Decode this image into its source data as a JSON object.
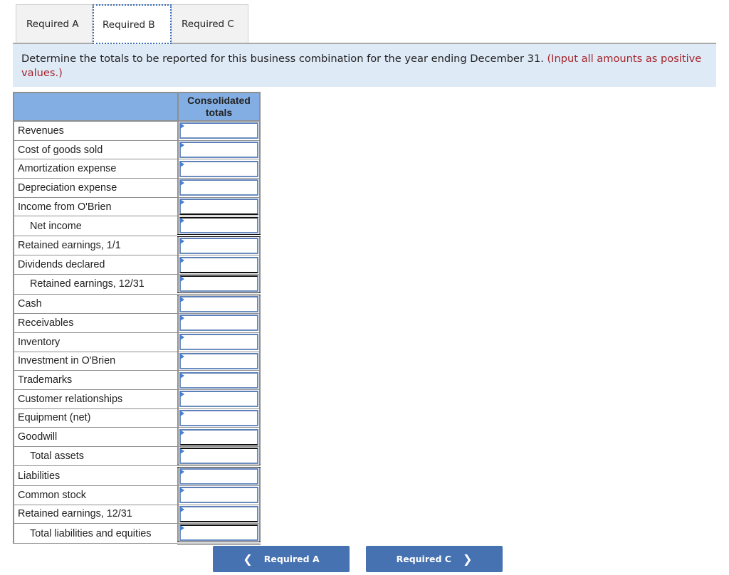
{
  "tabs": [
    {
      "label": "Required A",
      "active": false
    },
    {
      "label": "Required B",
      "active": true
    },
    {
      "label": "Required C",
      "active": false
    }
  ],
  "instruction": {
    "text": "Determine the totals to be reported for this business combination for the year ending December 31. ",
    "note": "(Input all amounts as positive values.)"
  },
  "table": {
    "header_label": "",
    "header_value": "Consolidated totals",
    "rows": [
      {
        "label": "Revenues",
        "value": "",
        "indent": false,
        "total": false
      },
      {
        "label": "Cost of goods sold",
        "value": "",
        "indent": false,
        "total": false
      },
      {
        "label": "Amortization expense",
        "value": "",
        "indent": false,
        "total": false
      },
      {
        "label": "Depreciation expense",
        "value": "",
        "indent": false,
        "total": false
      },
      {
        "label": "Income from O'Brien",
        "value": "",
        "indent": false,
        "total": false
      },
      {
        "label": "Net income",
        "value": "",
        "indent": true,
        "total": true
      },
      {
        "label": "Retained earnings, 1/1",
        "value": "",
        "indent": false,
        "total": false
      },
      {
        "label": "Dividends declared",
        "value": "",
        "indent": false,
        "total": false
      },
      {
        "label": "Retained earnings, 12/31",
        "value": "",
        "indent": true,
        "total": true
      },
      {
        "label": "Cash",
        "value": "",
        "indent": false,
        "total": false
      },
      {
        "label": "Receivables",
        "value": "",
        "indent": false,
        "total": false
      },
      {
        "label": "Inventory",
        "value": "",
        "indent": false,
        "total": false
      },
      {
        "label": "Investment in O'Brien",
        "value": "",
        "indent": false,
        "total": false
      },
      {
        "label": "Trademarks",
        "value": "",
        "indent": false,
        "total": false
      },
      {
        "label": "Customer relationships",
        "value": "",
        "indent": false,
        "total": false
      },
      {
        "label": "Equipment (net)",
        "value": "",
        "indent": false,
        "total": false
      },
      {
        "label": "Goodwill",
        "value": "",
        "indent": false,
        "total": false
      },
      {
        "label": "Total assets",
        "value": "",
        "indent": true,
        "total": true
      },
      {
        "label": "Liabilities",
        "value": "",
        "indent": false,
        "total": false
      },
      {
        "label": "Common stock",
        "value": "",
        "indent": false,
        "total": false
      },
      {
        "label": "Retained earnings, 12/31",
        "value": "",
        "indent": false,
        "total": false
      },
      {
        "label": "Total liabilities and equities",
        "value": "",
        "indent": true,
        "total": true
      }
    ]
  },
  "nav": {
    "prev_label": "Required A",
    "prev_icon": "chevron-left-icon",
    "next_label": "Required C",
    "next_icon": "chevron-right-icon"
  },
  "colors": {
    "header_bg": "#83aee3",
    "instruction_bg": "#dfeaf7",
    "note_text": "#a3242b",
    "button_bg": "#4672b2",
    "input_marker": "#4a7fd0"
  }
}
